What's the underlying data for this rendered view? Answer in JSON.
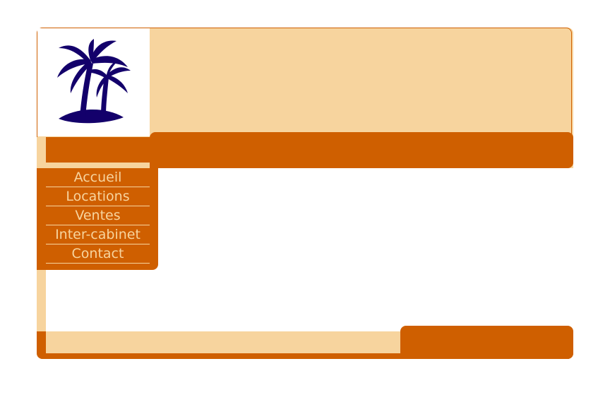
{
  "logo": {
    "icon": "palm-trees-icon",
    "color": "#13006b"
  },
  "colors": {
    "accent": "#cf5f00",
    "light": "#f7d49e",
    "background": "#ffffff"
  },
  "nav": {
    "items": [
      {
        "label": "Accueil"
      },
      {
        "label": "Locations"
      },
      {
        "label": "Ventes"
      },
      {
        "label": "Inter-cabinet"
      },
      {
        "label": "Contact"
      }
    ]
  }
}
